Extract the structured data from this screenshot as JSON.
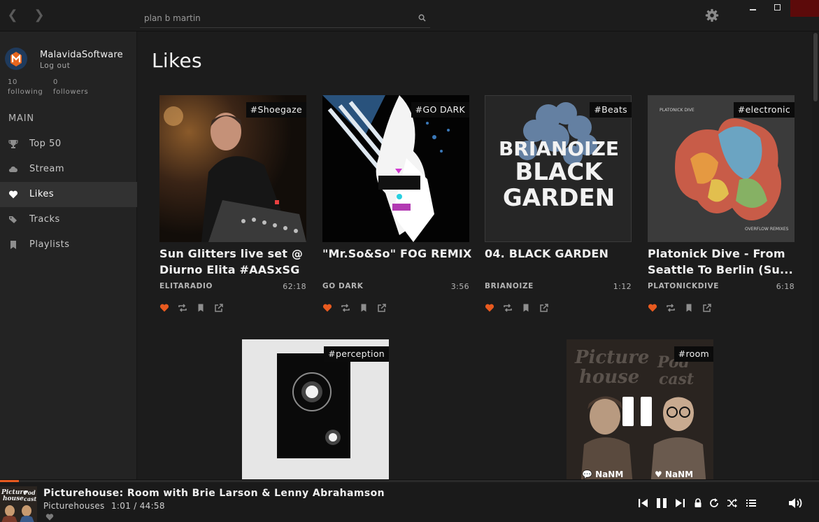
{
  "app": {
    "accent": "#e85a1f",
    "search": {
      "value": "plan b martin"
    }
  },
  "sidebar": {
    "user": {
      "name": "MalavidaSoftware",
      "logout": "Log out"
    },
    "stats": {
      "following_count": "10",
      "following_label": "following",
      "followers_count": "0",
      "followers_label": "followers"
    },
    "section": "MAIN",
    "items": [
      {
        "label": "Top 50",
        "icon": "trophy-icon",
        "active": false
      },
      {
        "label": "Stream",
        "icon": "cloud-icon",
        "active": false
      },
      {
        "label": "Likes",
        "icon": "heart-icon",
        "active": true
      },
      {
        "label": "Tracks",
        "icon": "tags-icon",
        "active": false
      },
      {
        "label": "Playlists",
        "icon": "bookmark-icon",
        "active": false
      }
    ]
  },
  "main": {
    "title": "Likes",
    "tracks": [
      {
        "tag": "#Shoegaze",
        "title_line1": "Sun Glitters live set @",
        "title_line2": "Diurno Elita #AASxSG",
        "artist": "ELITARADIO",
        "duration": "62:18",
        "liked": true
      },
      {
        "tag": "#GO DARK",
        "title_line1": "\"Mr.So&So\" FOG REMIX",
        "title_line2": "",
        "artist": "GO DARK",
        "duration": "3:56",
        "liked": true
      },
      {
        "tag": "#Beats",
        "title_line1": "04. BLACK GARDEN",
        "title_line2": "",
        "artist": "BRIANOIZE",
        "duration": "1:12",
        "liked": true,
        "art_text": [
          "BRIANOIZE",
          "BLACK",
          "GARDEN"
        ]
      },
      {
        "tag": "#electronic",
        "title_line1": "Platonick Dive - From",
        "title_line2": "Seattle To Berlin (Su...",
        "artist": "PLATONICKDIVE",
        "duration": "6:18",
        "liked": true,
        "art_text": [
          "PLATONICK DIVE",
          "OVERFLOW REMIXES"
        ]
      },
      {
        "tag": "#perception"
      },
      {
        "tag": "#room",
        "comments": "NaNM",
        "likes": "NaNM",
        "art_text": [
          "Picture",
          "house",
          "Pod",
          "cast"
        ]
      }
    ]
  },
  "player": {
    "title": "Picturehouse: Room with Brie Larson & Lenny Abrahamson",
    "artist": "Picturehouses",
    "time": "1:01 /  44:58",
    "progress": 0.0227,
    "art_text": [
      "Picture",
      "house",
      "Pod",
      "cast"
    ]
  }
}
